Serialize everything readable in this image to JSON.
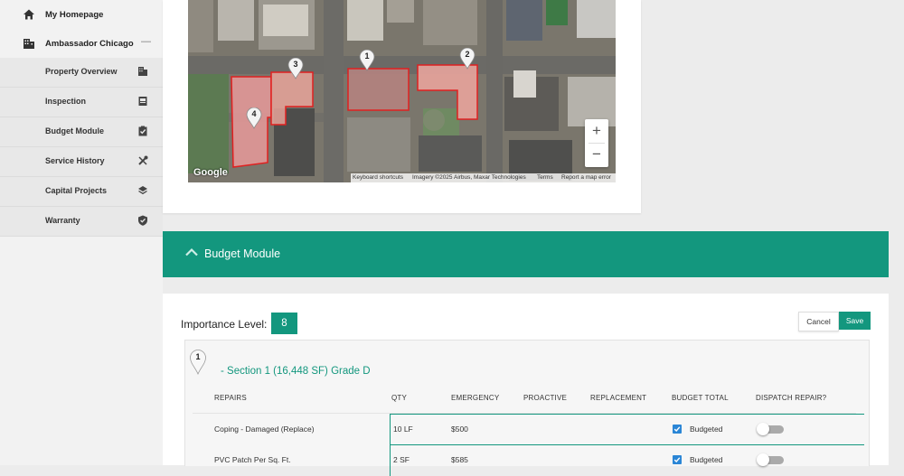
{
  "sidebar": {
    "homepage": "My Homepage",
    "property": "Ambassador Chicago",
    "collapse_symbol": "—",
    "items": [
      {
        "label": "Property Overview",
        "icon": "building-icon"
      },
      {
        "label": "Inspection",
        "icon": "report-icon"
      },
      {
        "label": "Budget Module",
        "icon": "clipboard-check-icon"
      },
      {
        "label": "Service History",
        "icon": "tools-icon"
      },
      {
        "label": "Capital Projects",
        "icon": "layers-icon"
      },
      {
        "label": "Warranty",
        "icon": "shield-check-icon"
      }
    ]
  },
  "map": {
    "markers": [
      "1",
      "2",
      "3",
      "4"
    ],
    "zoom_in": "+",
    "zoom_out": "−",
    "google": "Google",
    "attribution": [
      "Keyboard shortcuts",
      "Imagery ©2025 Airbus, Maxar Technologies",
      "Terms",
      "Report a map error"
    ]
  },
  "budget": {
    "title": "Budget Module",
    "importance_label": "Importance Level:",
    "importance_value": "8",
    "cancel": "Cancel",
    "save": "Save",
    "section_marker": "1",
    "section_title": "- Section 1 (16,448 SF) Grade D",
    "columns": [
      "REPAIRS",
      "QTY",
      "EMERGENCY",
      "PROACTIVE",
      "REPLACEMENT",
      "BUDGET TOTAL",
      "DISPATCH REPAIR?"
    ],
    "rows": [
      {
        "repair": "Coping - Damaged (Replace)",
        "qty": "10 LF",
        "emergency": "$500",
        "proactive": "",
        "replacement": "",
        "budget_total": "Budgeted",
        "checked": true,
        "dispatch": false
      },
      {
        "repair": "PVC Patch Per Sq. Ft.",
        "qty": "2 SF",
        "emergency": "$585",
        "proactive": "",
        "replacement": "",
        "budget_total": "Budgeted",
        "checked": true,
        "dispatch": false
      }
    ]
  },
  "colors": {
    "accent": "#13977e",
    "checkbox": "#2b86d6",
    "marker_outline": "#e02020"
  }
}
